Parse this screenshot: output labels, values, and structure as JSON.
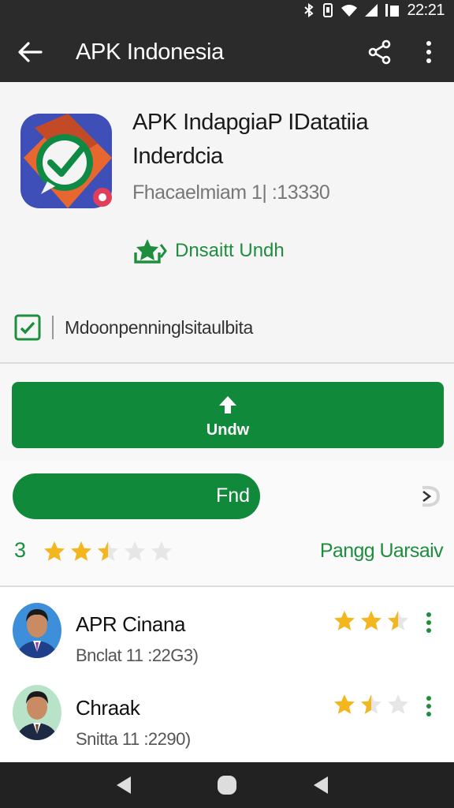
{
  "status_bar": {
    "time": "22:21",
    "icons": [
      "bluetooth-icon",
      "vibrate-icon",
      "wifi-icon",
      "signal-icon",
      "battery-icon"
    ]
  },
  "app_bar": {
    "title": "APK Indonesia",
    "icons": [
      "back-arrow-icon",
      "share-icon",
      "more-vert-icon"
    ]
  },
  "app": {
    "name_line1": "APK IndapgiaP IDatatiia",
    "name_line2": "Inderdcia",
    "meta": "Fhacaelmiam 1| :13330",
    "install_label": "Dnsaitt Undh"
  },
  "permissions": {
    "label": "Mdoonpenninglsitaulbita"
  },
  "download_button": {
    "label": "Undw"
  },
  "find_button": {
    "label": "Fnd"
  },
  "rating": {
    "value_label": "3",
    "stars": 2.5,
    "link": "Pangg Uarsaiv"
  },
  "reviews": [
    {
      "name": "APR Cinana",
      "meta": "Bnclat 11 :22G3)",
      "stars": 2.5
    },
    {
      "name": "Chraak",
      "meta": "Snitta 11 :2290)",
      "stars": 1.5
    }
  ],
  "colors": {
    "accent_green": "#11893a",
    "star_yellow": "#f3b61f",
    "bar_dark": "#2b2b2b"
  }
}
